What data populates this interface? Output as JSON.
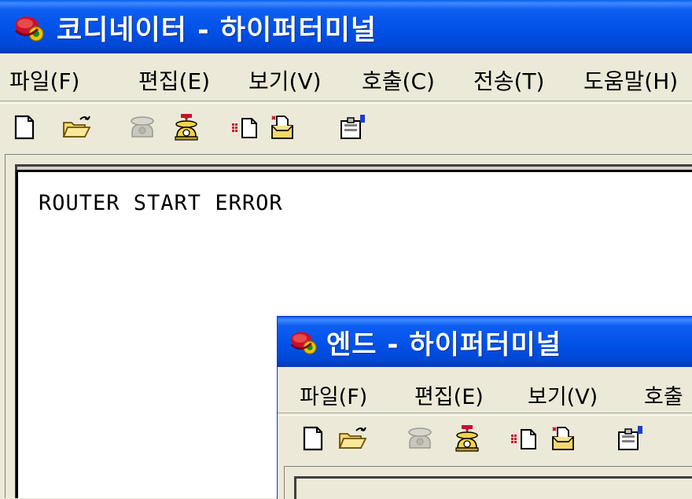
{
  "colors": {
    "titlebar": "#0054e3",
    "window_bg": "#ece9d8",
    "terminal_bg": "#ffffff"
  },
  "main_window": {
    "title": "코디네이터 - 하이퍼터미널",
    "menu": [
      "파일(F)",
      "편집(E)",
      "보기(V)",
      "호출(C)",
      "전송(T)",
      "도움말(H)"
    ],
    "toolbar": [
      "new-icon",
      "open-folder-icon",
      "connect-phone-icon",
      "disconnect-phone-icon",
      "send-file-icon",
      "receive-file-icon",
      "properties-icon"
    ],
    "terminal_text": "ROUTER START ERROR"
  },
  "child_window": {
    "title": "엔드 - 하이퍼터미널",
    "menu": [
      "파일(F)",
      "편집(E)",
      "보기(V)",
      "호출"
    ],
    "toolbar": [
      "new-icon",
      "open-folder-icon",
      "connect-phone-icon",
      "disconnect-phone-icon",
      "send-file-icon",
      "receive-file-icon",
      "properties-icon"
    ]
  }
}
